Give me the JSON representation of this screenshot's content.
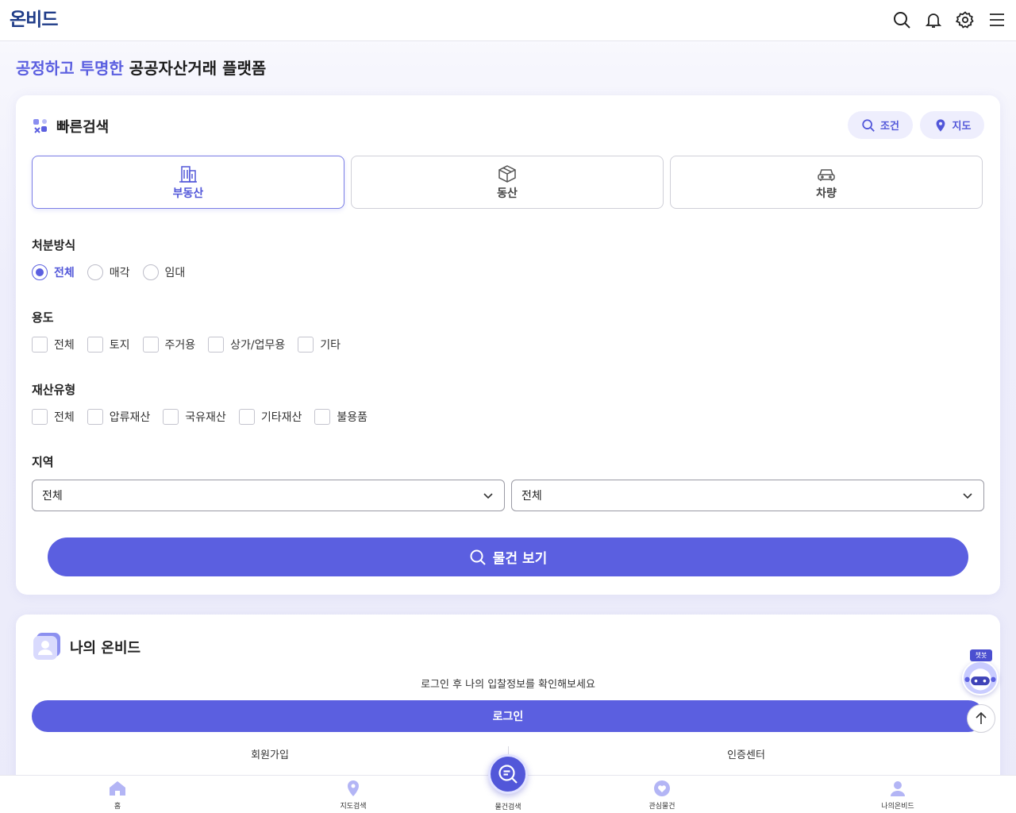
{
  "header": {
    "logo": "온비드",
    "icons": [
      "search-icon",
      "bell-icon",
      "gear-icon",
      "menu-icon"
    ]
  },
  "tagline": {
    "accent": "공정하고 투명한",
    "rest": " 공공자산거래 플랫폼"
  },
  "quick_search": {
    "title": "빠른검색",
    "pills": {
      "condition": "조건",
      "map": "지도"
    },
    "tabs": [
      {
        "label": "부동산",
        "icon": "building-icon",
        "active": true
      },
      {
        "label": "동산",
        "icon": "box-icon",
        "active": false
      },
      {
        "label": "차량",
        "icon": "car-icon",
        "active": false
      }
    ],
    "disposal": {
      "label": "처분방식",
      "options": [
        "전체",
        "매각",
        "임대"
      ],
      "selected": "전체"
    },
    "usage": {
      "label": "용도",
      "options": [
        "전체",
        "토지",
        "주거용",
        "상가/업무용",
        "기타"
      ]
    },
    "property_type": {
      "label": "재산유형",
      "options": [
        "전체",
        "압류재산",
        "국유재산",
        "기타재산",
        "불용품"
      ]
    },
    "region": {
      "label": "지역",
      "select1": "전체",
      "select2": "전체"
    },
    "search_button": "물건 보기"
  },
  "my_onbid": {
    "title": "나의 온비드",
    "message": "로그인 후 나의 입찰정보를 확인해보세요",
    "login_button": "로그인",
    "signup_link": "회원가입",
    "cert_link": "인증센터"
  },
  "chatbot": {
    "tag": "챗봇"
  },
  "bottom_nav": {
    "home": "홈",
    "map_search": "지도검색",
    "item_search": "물건검색",
    "favorites": "관심물건",
    "my": "나의온비드"
  },
  "colors": {
    "accent": "#5b5fe0",
    "logo": "#1f3c88",
    "pill_bg": "#eeeefd"
  }
}
